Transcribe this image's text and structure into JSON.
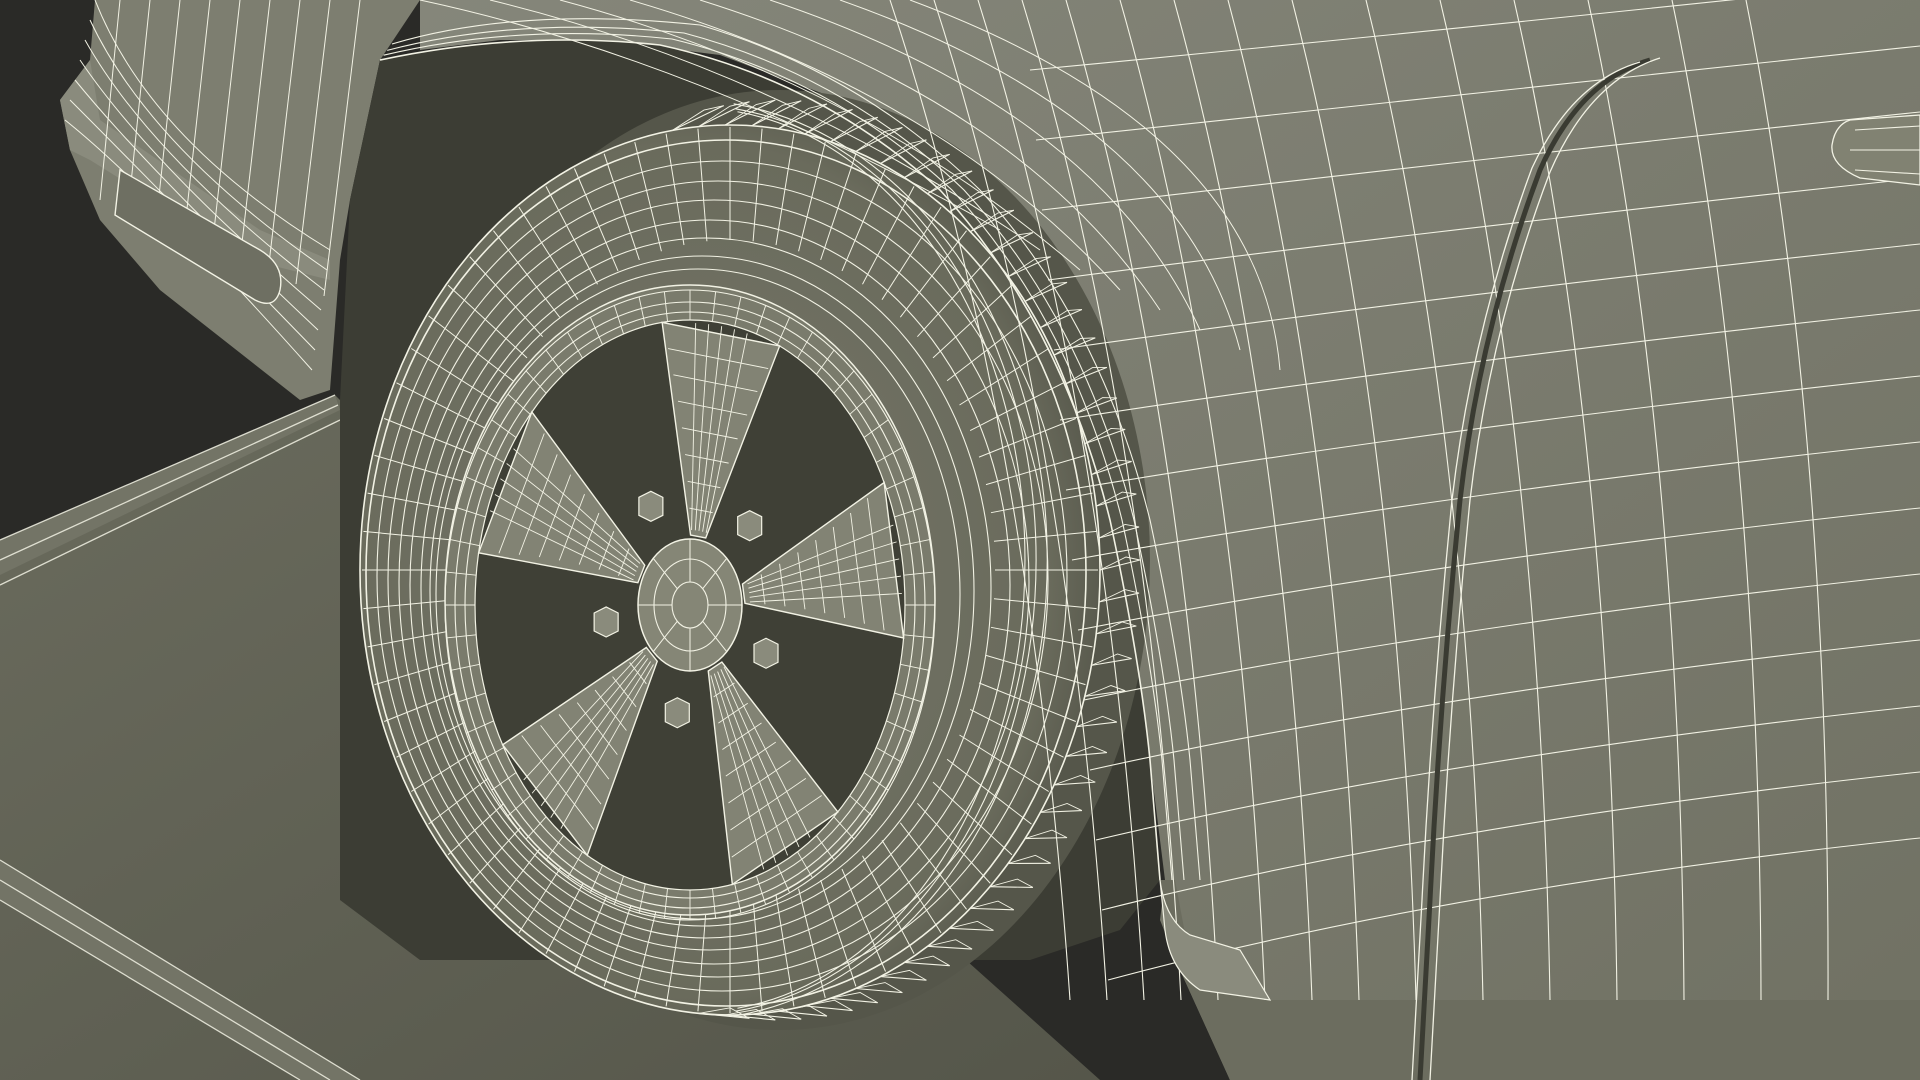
{
  "scene": {
    "subject": "wireframe-car-front-wheel",
    "render_mode": "wireframe-over-shaded",
    "colors": {
      "background": "#2a2a27",
      "floor": "#5c5d50",
      "floor_light": "#6b6c5e",
      "body": "#7a7b6b",
      "body_shadow": "#55564a",
      "wheel_well": "#3c3d34",
      "tire": "#6a6b5c",
      "tire_shadow": "#4a4b40",
      "rim": "#7b7c6b",
      "wire": "#f2f2e4"
    },
    "wheel": {
      "spoke_count": 5,
      "lug_nut_count": 5
    }
  }
}
